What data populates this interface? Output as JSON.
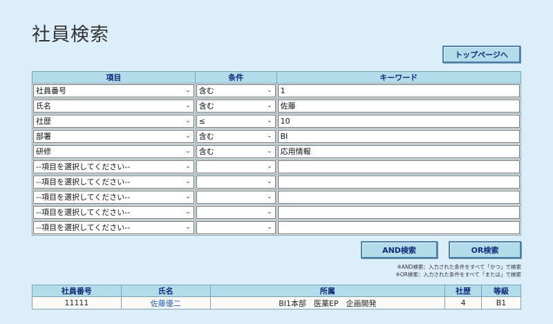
{
  "page": {
    "title": "社員検索"
  },
  "buttons": {
    "top_page": "トップページへ",
    "and_search": "AND検索",
    "or_search": "OR検索"
  },
  "condition_table": {
    "headers": [
      "項目",
      "条件",
      "キーワード"
    ],
    "rows": [
      {
        "item": "社員番号",
        "cond": "含む",
        "keyword": "1"
      },
      {
        "item": "氏名",
        "cond": "含む",
        "keyword": "佐藤"
      },
      {
        "item": "社歴",
        "cond": "≤",
        "keyword": "10"
      },
      {
        "item": "部署",
        "cond": "含む",
        "keyword": "BI"
      },
      {
        "item": "研修",
        "cond": "含む",
        "keyword": "応用情報"
      },
      {
        "item": "--項目を選択してください--",
        "cond": "",
        "keyword": ""
      },
      {
        "item": "--項目を選択してください--",
        "cond": "",
        "keyword": ""
      },
      {
        "item": "--項目を選択してください--",
        "cond": "",
        "keyword": ""
      },
      {
        "item": "--項目を選択してください--",
        "cond": "",
        "keyword": ""
      },
      {
        "item": "--項目を選択してください--",
        "cond": "",
        "keyword": ""
      }
    ]
  },
  "notes": {
    "and_note": "※AND検索：入力された条件をすべて「かつ」で検索",
    "or_note": "※OR検索：入力された条件をすべて「または」で検索"
  },
  "result_table": {
    "headers": [
      "社員番号",
      "氏名",
      "所属",
      "社歴",
      "等級"
    ],
    "rows": [
      {
        "id": "11111",
        "name": "佐藤優二",
        "dept": "BI1本部　医薬EP　企画開発",
        "years": "4",
        "grade": "B1"
      }
    ]
  },
  "colors": {
    "background": "#ddeefb",
    "header_bg": "#b3dcea",
    "header_text": "#0e2a7a",
    "link": "#2a5db8"
  },
  "icons": {
    "dropdown": "chevron-down-icon"
  }
}
